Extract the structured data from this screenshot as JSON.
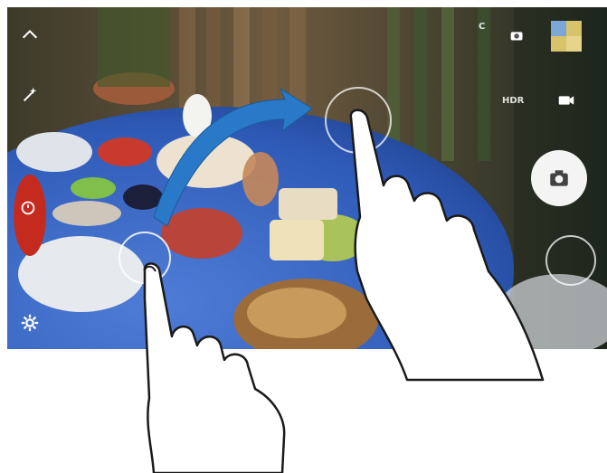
{
  "camera": {
    "mode_label_top": "C",
    "mode_label_hdr": "HDR",
    "icons": {
      "collapse": "chevron-up-icon",
      "effects": "magic-wand-icon",
      "timer": "timer-icon",
      "settings": "gear-icon",
      "mode": "camera-mode-icon",
      "video": "video-record-icon",
      "shutter": "camera-shutter-icon",
      "gallery": "gallery-thumbnail"
    }
  },
  "gesture": {
    "type": "drag-swipe",
    "direction": "to-top-right",
    "arrow_color": "#2a78c8"
  }
}
